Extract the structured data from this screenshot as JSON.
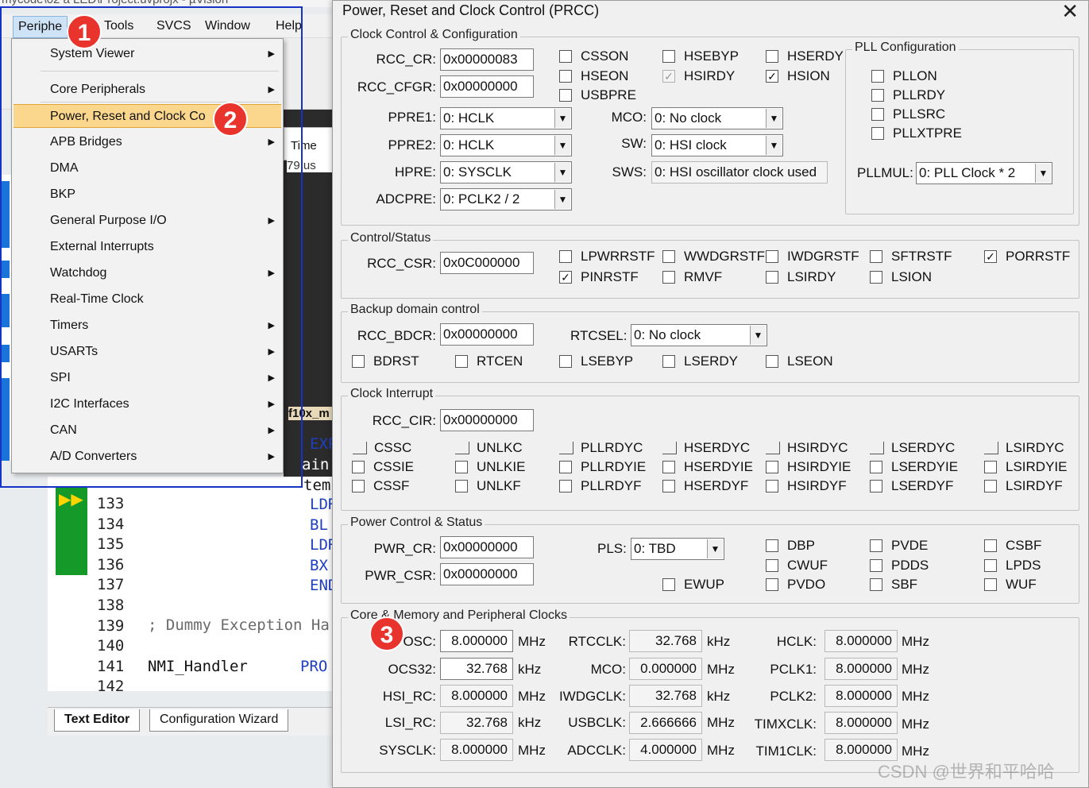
{
  "ide": {
    "title": "mycode\\02 a LED\\Project.uvprojx - µVision",
    "menu": {
      "peripherals": "Periphe",
      "tools": "Tools",
      "svcs": "SVCS",
      "window": "Window",
      "help": "Help"
    },
    "pane_header": "Time",
    "pane_value": "79 us",
    "tabname": "f10x_m",
    "line_numbers": [
      "133",
      "134",
      "135",
      "136",
      "137",
      "138",
      "139",
      "140",
      "141",
      "142"
    ],
    "code_comment": "; Dummy Exception Ha",
    "code_handler": "NMI_Handler",
    "code_proc": "PRO",
    "kw": [
      "LDR",
      "BL",
      "LDR",
      "BX",
      "END"
    ],
    "kw_exp": "EXP",
    "kw_main": "ain",
    "kw_tem": "tem",
    "tabs": {
      "text_editor": "Text Editor",
      "config_wizard": "Configuration Wizard"
    }
  },
  "menu_items": [
    {
      "label": "System Viewer",
      "submenu": true
    },
    {
      "label": "Core Peripherals",
      "submenu": true
    },
    {
      "label": "Power, Reset and Clock Co",
      "submenu": false,
      "highlighted": true
    },
    {
      "label": "APB Bridges",
      "submenu": true
    },
    {
      "label": "DMA",
      "submenu": false
    },
    {
      "label": "BKP",
      "submenu": false
    },
    {
      "label": "General Purpose I/O",
      "submenu": true
    },
    {
      "label": "External Interrupts",
      "submenu": false
    },
    {
      "label": "Watchdog",
      "submenu": true
    },
    {
      "label": "Real-Time Clock",
      "submenu": false
    },
    {
      "label": "Timers",
      "submenu": true
    },
    {
      "label": "USARTs",
      "submenu": true
    },
    {
      "label": "SPI",
      "submenu": true
    },
    {
      "label": "I2C Interfaces",
      "submenu": true
    },
    {
      "label": "CAN",
      "submenu": true
    },
    {
      "label": "A/D Converters",
      "submenu": true
    }
  ],
  "badges": {
    "one": "1",
    "two": "2",
    "three": "3"
  },
  "dialog": {
    "title": "Power, Reset and Clock Control (PRCC)",
    "close": "✕",
    "clock": {
      "group": "Clock Control & Configuration",
      "rcc_cr_label": "RCC_CR:",
      "rcc_cr": "0x00000083",
      "rcc_cfgr_label": "RCC_CFGR:",
      "rcc_cfgr": "0x00000000",
      "ppre1_label": "PPRE1:",
      "ppre1": "0: HCLK",
      "ppre2_label": "PPRE2:",
      "ppre2": "0: HCLK",
      "hpre_label": "HPRE:",
      "hpre": "0: SYSCLK",
      "adcpre_label": "ADCPRE:",
      "adcpre": "0: PCLK2 / 2",
      "mco_label": "MCO:",
      "mco": "0: No clock",
      "sw_label": "SW:",
      "sw": "0: HSI clock",
      "sws_label": "SWS:",
      "sws": "0: HSI oscillator clock used",
      "checks": {
        "csson": "CSSON",
        "hseon": "HSEON",
        "usbpre": "USBPRE",
        "hsebyp": "HSEBYP",
        "hsirdy": "HSIRDY",
        "hserdy": "HSERDY",
        "hsion": "HSION"
      }
    },
    "pll": {
      "group": "PLL Configuration",
      "pllon": "PLLON",
      "pllrdy": "PLLRDY",
      "pllsrc": "PLLSRC",
      "pllxtpre": "PLLXTPRE",
      "pllmul_label": "PLLMUL:",
      "pllmul": "0: PLL Clock * 2"
    },
    "csr": {
      "group": "Control/Status",
      "label": "RCC_CSR:",
      "value": "0x0C000000",
      "lpwrrstf": "LPWRRSTF",
      "wwdgrstf": "WWDGRSTF",
      "iwdgrstf": "IWDGRSTF",
      "sftrstf": "SFTRSTF",
      "porrstf": "PORRSTF",
      "pinrstf": "PINRSTF",
      "rmvf": "RMVF",
      "lsirdy": "LSIRDY",
      "lsion": "LSION"
    },
    "bdcr": {
      "group": "Backup domain control",
      "label": "RCC_BDCR:",
      "value": "0x00000000",
      "rtcsel_label": "RTCSEL:",
      "rtcsel": "0: No clock",
      "bdrst": "BDRST",
      "rtcen": "RTCEN",
      "lsebyp": "LSEBYP",
      "lserdy": "LSERDY",
      "lseon": "LSEON"
    },
    "cir": {
      "group": "Clock Interrupt",
      "label": "RCC_CIR:",
      "value": "0x00000000",
      "row1": [
        "CSSC",
        "UNLKC",
        "PLLRDYC",
        "HSERDYC",
        "HSIRDYC",
        "LSERDYC",
        "LSIRDYC"
      ],
      "row2": [
        "CSSIE",
        "UNLKIE",
        "PLLRDYIE",
        "HSERDYIE",
        "HSIRDYIE",
        "LSERDYIE",
        "LSIRDYIE"
      ],
      "row3": [
        "CSSF",
        "UNLKF",
        "PLLRDYF",
        "HSERDYF",
        "HSIRDYF",
        "LSERDYF",
        "LSIRDYF"
      ]
    },
    "pwr": {
      "group": "Power Control & Status",
      "cr_label": "PWR_CR:",
      "cr": "0x00000000",
      "csr_label": "PWR_CSR:",
      "csr": "0x00000000",
      "pls_label": "PLS:",
      "pls": "0: TBD",
      "ewup": "EWUP",
      "dbp": "DBP",
      "cwuf": "CWUF",
      "pvdo": "PVDO",
      "pvde": "PVDE",
      "pdds": "PDDS",
      "sbf": "SBF",
      "csbf": "CSBF",
      "lpds": "LPDS",
      "wuf": "WUF"
    },
    "clocks": {
      "group": "Core & Memory and Peripheral Clocks",
      "osc_label": "OSC:",
      "osc": "8.000000",
      "osc_unit": "MHz",
      "ocs32_label": "OCS32:",
      "ocs32": "32.768",
      "ocs32_unit": "kHz",
      "hsirc_label": "HSI_RC:",
      "hsirc": "8.000000",
      "hsirc_unit": "MHz",
      "lsirc_label": "LSI_RC:",
      "lsirc": "32.768",
      "lsirc_unit": "kHz",
      "sysclk_label": "SYSCLK:",
      "sysclk": "8.000000",
      "sysclk_unit": "MHz",
      "rtcclk_label": "RTCCLK:",
      "rtcclk": "32.768",
      "rtcclk_unit": "kHz",
      "mco_label": "MCO:",
      "mco": "0.000000",
      "mco_unit": "MHz",
      "iwdgclk_label": "IWDGCLK:",
      "iwdgclk": "32.768",
      "iwdgclk_unit": "kHz",
      "usbclk_label": "USBCLK:",
      "usbclk": "2.666666",
      "usbclk_unit": "MHz",
      "adcclk_label": "ADCCLK:",
      "adcclk": "4.000000",
      "adcclk_unit": "MHz",
      "hclk_label": "HCLK:",
      "hclk": "8.000000",
      "hclk_unit": "MHz",
      "pclk1_label": "PCLK1:",
      "pclk1": "8.000000",
      "pclk1_unit": "MHz",
      "pclk2_label": "PCLK2:",
      "pclk2": "8.000000",
      "pclk2_unit": "MHz",
      "timxclk_label": "TIMXCLK:",
      "timxclk": "8.000000",
      "timxclk_unit": "MHz",
      "tim1clk_label": "TIM1CLK:",
      "tim1clk": "8.000000",
      "tim1clk_unit": "MHz"
    }
  },
  "watermark": "CSDN @世界和平哈哈"
}
